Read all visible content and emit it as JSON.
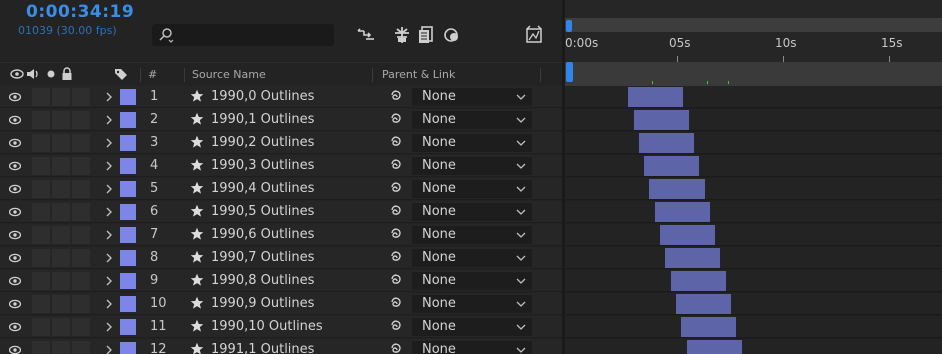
{
  "header": {
    "timecode": "0:00:34:19",
    "frames_info": "01039 (30.00 fps)",
    "search_placeholder": ""
  },
  "columns": {
    "number": "#",
    "source_name": "Source Name",
    "parent_link": "Parent & Link"
  },
  "ruler": {
    "ticks": [
      "0:00s",
      "05s",
      "10s",
      "15s"
    ]
  },
  "layers": [
    {
      "number": "1",
      "name": "1990,0 Outlines",
      "parent": "None",
      "in_sec": 2.7,
      "out_sec": 5.3
    },
    {
      "number": "2",
      "name": "1990,1 Outlines",
      "parent": "None",
      "in_sec": 2.95,
      "out_sec": 5.55
    },
    {
      "number": "3",
      "name": "1990,2 Outlines",
      "parent": "None",
      "in_sec": 3.2,
      "out_sec": 5.8
    },
    {
      "number": "4",
      "name": "1990,3 Outlines",
      "parent": "None",
      "in_sec": 3.45,
      "out_sec": 6.05
    },
    {
      "number": "5",
      "name": "1990,4 Outlines",
      "parent": "None",
      "in_sec": 3.7,
      "out_sec": 6.3
    },
    {
      "number": "6",
      "name": "1990,5 Outlines",
      "parent": "None",
      "in_sec": 3.95,
      "out_sec": 6.55
    },
    {
      "number": "7",
      "name": "1990,6 Outlines",
      "parent": "None",
      "in_sec": 4.2,
      "out_sec": 6.8
    },
    {
      "number": "8",
      "name": "1990,7 Outlines",
      "parent": "None",
      "in_sec": 4.45,
      "out_sec": 7.05
    },
    {
      "number": "9",
      "name": "1990,8 Outlines",
      "parent": "None",
      "in_sec": 4.7,
      "out_sec": 7.3
    },
    {
      "number": "10",
      "name": "1990,9 Outlines",
      "parent": "None",
      "in_sec": 4.95,
      "out_sec": 7.55
    },
    {
      "number": "11",
      "name": "1990,10 Outlines",
      "parent": "None",
      "in_sec": 5.2,
      "out_sec": 7.8
    },
    {
      "number": "12",
      "name": "1991,1 Outlines",
      "parent": "None",
      "in_sec": 5.45,
      "out_sec": 8.05
    }
  ],
  "colors": {
    "timecode": "#3a8ee6",
    "label": "#7d86e6",
    "layer_bar": "#5d65a8",
    "cti": "#2f86e8",
    "marker": "#3ec24a"
  },
  "icons": {
    "search": "search-icon",
    "visibility": "eye-icon",
    "audio": "speaker-icon",
    "solo": "solo-icon",
    "lock": "lock-icon",
    "label": "tag-icon",
    "shy": "shy-layers-icon",
    "motion_blur": "motion-blur-icon",
    "frame_blend": "frame-blend-icon",
    "draft_3d": "draft-3d-icon",
    "graph_editor": "graph-editor-icon",
    "twirl": "chevron-right-icon",
    "source_type": "star-icon",
    "parent_pick": "pick-whip-icon",
    "dropdown": "chevron-down-icon"
  }
}
